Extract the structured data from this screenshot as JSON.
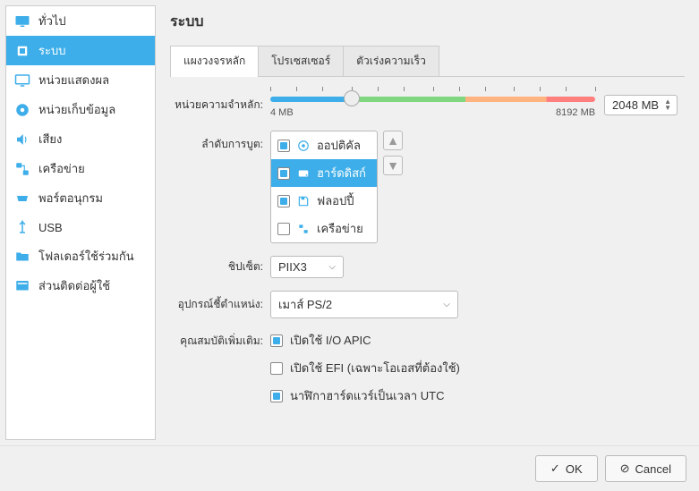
{
  "title": "ระบบ",
  "sidebar": {
    "items": [
      {
        "label": "ทั่วไป"
      },
      {
        "label": "ระบบ"
      },
      {
        "label": "หน่วยแสดงผล"
      },
      {
        "label": "หน่วยเก็บข้อมูล"
      },
      {
        "label": "เสียง"
      },
      {
        "label": "เครือข่าย"
      },
      {
        "label": "พอร์ตอนุกรม"
      },
      {
        "label": "USB"
      },
      {
        "label": "โฟลเดอร์ใช้ร่วมกัน"
      },
      {
        "label": "ส่วนติดต่อผู้ใช้"
      }
    ]
  },
  "tabs": [
    {
      "label": "แผงวงจรหลัก"
    },
    {
      "label": "โปรเซสเซอร์"
    },
    {
      "label": "ตัวเร่งความเร็ว"
    }
  ],
  "memory": {
    "label": "หน่วยความจำหลัก:",
    "min": "4 MB",
    "max": "8192 MB",
    "value": "2048 MB"
  },
  "bootOrder": {
    "label": "ลำดับการบูต:",
    "items": [
      {
        "label": "ออปติคัล"
      },
      {
        "label": "ฮาร์ดดิสก์"
      },
      {
        "label": "ฟลอปปี้"
      },
      {
        "label": "เครือข่าย"
      }
    ]
  },
  "chipset": {
    "label": "ชิปเซ็ต:",
    "value": "PIIX3"
  },
  "pointing": {
    "label": "อุปกรณ์ชี้ตำแหน่ง:",
    "value": "เมาส์ PS/2"
  },
  "extended": {
    "label": "คุณสมบัติเพิ่มเติม:",
    "ioapic": "เปิดใช้ I/O APIC",
    "efi": "เปิดใช้ EFI (เฉพาะโอเอสที่ต้องใช้)",
    "utc": "นาฬิกาฮาร์ดแวร์เป็นเวลา UTC"
  },
  "buttons": {
    "ok": "OK",
    "cancel": "Cancel"
  }
}
